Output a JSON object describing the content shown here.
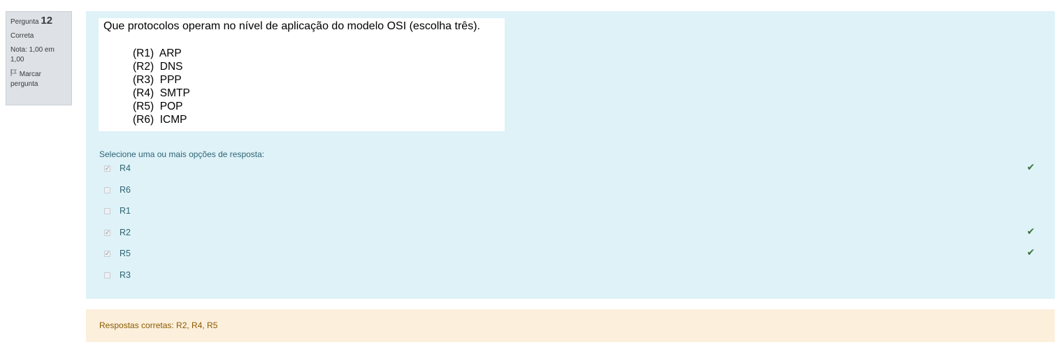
{
  "info": {
    "question_prefix": "Pergunta",
    "question_number": "12",
    "state": "Correta",
    "grade": "Nota: 1,00 em 1,00",
    "flag_label": "Marcar pergunta"
  },
  "question": {
    "title": "Que protocolos operam no nível de aplicação do modelo OSI (escolha três).",
    "items": [
      "(R1)  ARP",
      "(R2)  DNS",
      "(R3)  PPP",
      "(R4)  SMTP",
      "(R5)  POP",
      "(R6)  ICMP"
    ],
    "prompt": "Selecione uma ou mais opções de resposta:"
  },
  "answers": [
    {
      "label": "R4",
      "checked": true,
      "correct": true
    },
    {
      "label": "R6",
      "checked": false,
      "correct": false
    },
    {
      "label": "R1",
      "checked": false,
      "correct": false
    },
    {
      "label": "R2",
      "checked": true,
      "correct": true
    },
    {
      "label": "R5",
      "checked": true,
      "correct": true
    },
    {
      "label": "R3",
      "checked": false,
      "correct": false
    }
  ],
  "outcome": {
    "right_answer": "Respostas corretas: R2, R4, R5"
  },
  "colors": {
    "info_bg": "#dee2e6",
    "formulation_bg": "#def2f8",
    "outcome_bg": "#fcefdc",
    "correct_check": "#3c763d"
  },
  "icons": {
    "flag": "flag-icon",
    "correct": "check-icon"
  }
}
